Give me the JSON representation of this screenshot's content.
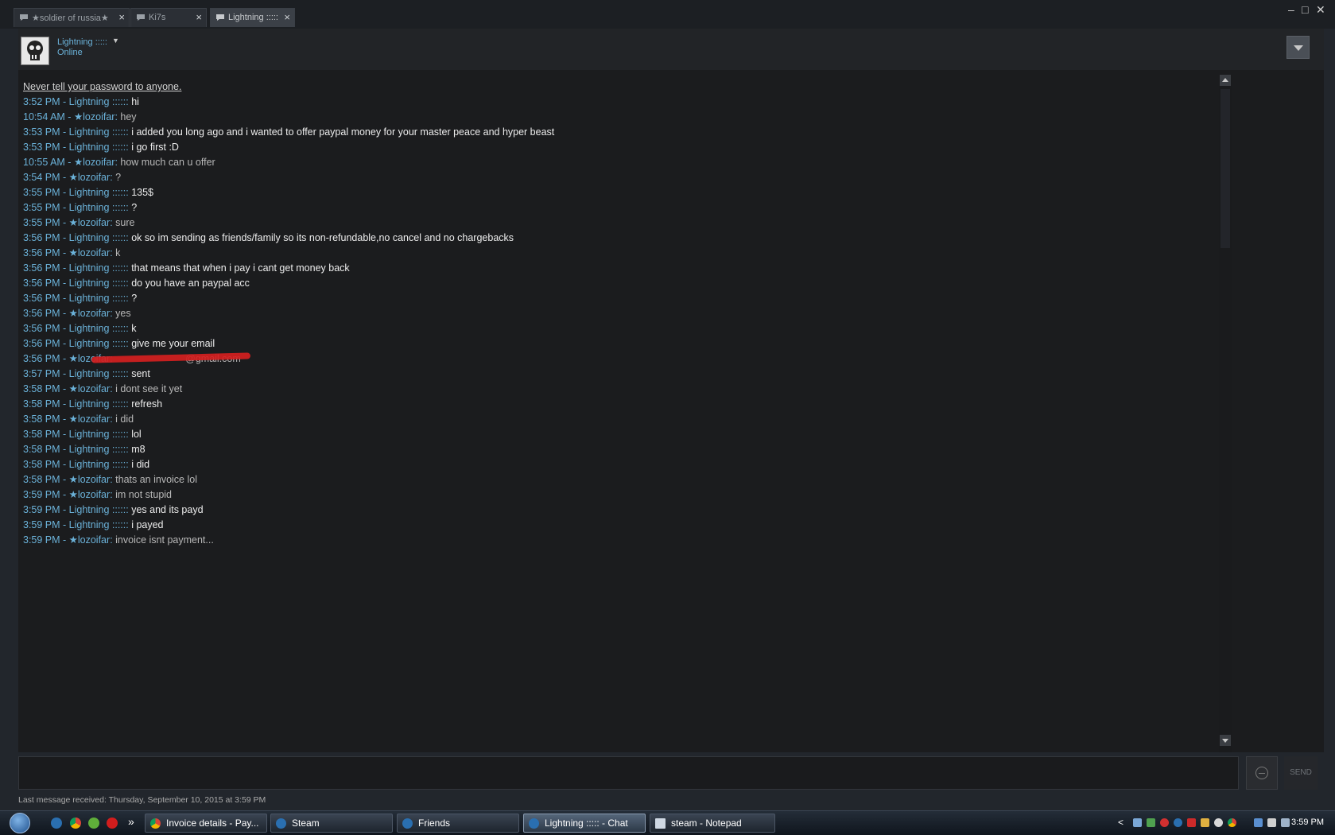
{
  "tabs": [
    {
      "label": "★soldier of russia★"
    },
    {
      "label": "Ki7s"
    },
    {
      "label": "Lightning :::::"
    }
  ],
  "window_controls": {
    "minimize": "–",
    "maximize": "□",
    "close": "✕"
  },
  "header": {
    "name": "Lightning :::::",
    "status": "Online"
  },
  "warning": "Never tell your password to anyone.",
  "messages": [
    {
      "time": "3:52 PM",
      "sender": "Lightning :::::",
      "text": "hi"
    },
    {
      "time": "10:54 AM",
      "sender": "★lozoifar",
      "text": "hey"
    },
    {
      "time": "3:53 PM",
      "sender": "Lightning :::::",
      "text": "i added you long ago and i wanted to offer paypal money for your master peace and hyper beast"
    },
    {
      "time": "3:53 PM",
      "sender": "Lightning :::::",
      "text": "i go first :D"
    },
    {
      "time": "10:55 AM",
      "sender": "★lozoifar",
      "text": "how much can u offer"
    },
    {
      "time": "3:54 PM",
      "sender": "★lozoifar",
      "text": "?"
    },
    {
      "time": "3:55 PM",
      "sender": "Lightning :::::",
      "text": "135$"
    },
    {
      "time": "3:55 PM",
      "sender": "Lightning :::::",
      "text": "?"
    },
    {
      "time": "3:55 PM",
      "sender": "★lozoifar",
      "text": "sure"
    },
    {
      "time": "3:56 PM",
      "sender": "Lightning :::::",
      "text": "ok so im sending as friends/family so its non-refundable,no cancel and no chargebacks"
    },
    {
      "time": "3:56 PM",
      "sender": "★lozoifar",
      "text": "k"
    },
    {
      "time": "3:56 PM",
      "sender": "Lightning :::::",
      "text": "that means that when i pay i cant get money back"
    },
    {
      "time": "3:56 PM",
      "sender": "Lightning :::::",
      "text": "do you have an paypal acc"
    },
    {
      "time": "3:56 PM",
      "sender": "Lightning :::::",
      "text": "?"
    },
    {
      "time": "3:56 PM",
      "sender": "★lozoifar",
      "text": "yes"
    },
    {
      "time": "3:56 PM",
      "sender": "Lightning :::::",
      "text": "k"
    },
    {
      "time": "3:56 PM",
      "sender": "Lightning :::::",
      "text": "give me your email"
    },
    {
      "time": "3:56 PM",
      "sender": "★lozoifar",
      "text": "@gmail.com"
    },
    {
      "time": "3:57 PM",
      "sender": "Lightning :::::",
      "text": "sent"
    },
    {
      "time": "3:58 PM",
      "sender": "★lozoifar",
      "text": "i dont see it yet"
    },
    {
      "time": "3:58 PM",
      "sender": "Lightning :::::",
      "text": "refresh"
    },
    {
      "time": "3:58 PM",
      "sender": "★lozoifar",
      "text": "i did"
    },
    {
      "time": "3:58 PM",
      "sender": "Lightning :::::",
      "text": "lol"
    },
    {
      "time": "3:58 PM",
      "sender": "Lightning :::::",
      "text": "m8"
    },
    {
      "time": "3:58 PM",
      "sender": "Lightning :::::",
      "text": "i did"
    },
    {
      "time": "3:58 PM",
      "sender": "★lozoifar",
      "text": "thats an invoice lol"
    },
    {
      "time": "3:59 PM",
      "sender": "★lozoifar",
      "text": "im not stupid"
    },
    {
      "time": "3:59 PM",
      "sender": "Lightning :::::",
      "text": "yes and its payd"
    },
    {
      "time": "3:59 PM",
      "sender": "Lightning :::::",
      "text": "i payed"
    },
    {
      "time": "3:59 PM",
      "sender": "★lozoifar",
      "text": "invoice isnt payment..."
    }
  ],
  "input": {
    "placeholder": "",
    "send_label": "SEND"
  },
  "last_message": "Last message received: Thursday, September 10, 2015 at 3:59 PM",
  "taskbar": {
    "items": [
      {
        "label": "Invoice details - Pay...",
        "icon": "chrome-icon"
      },
      {
        "label": "Steam",
        "icon": "steam-icon"
      },
      {
        "label": "Friends",
        "icon": "steam-icon"
      },
      {
        "label": "Lightning ::::: - Chat",
        "icon": "steam-icon"
      },
      {
        "label": "steam - Notepad",
        "icon": "notepad-icon"
      }
    ],
    "overflow": "»",
    "tray_arrow": "<",
    "clock": "3:59 PM"
  },
  "colors": {
    "accent": "#6bb2d9",
    "background": "#1b1c1e"
  }
}
